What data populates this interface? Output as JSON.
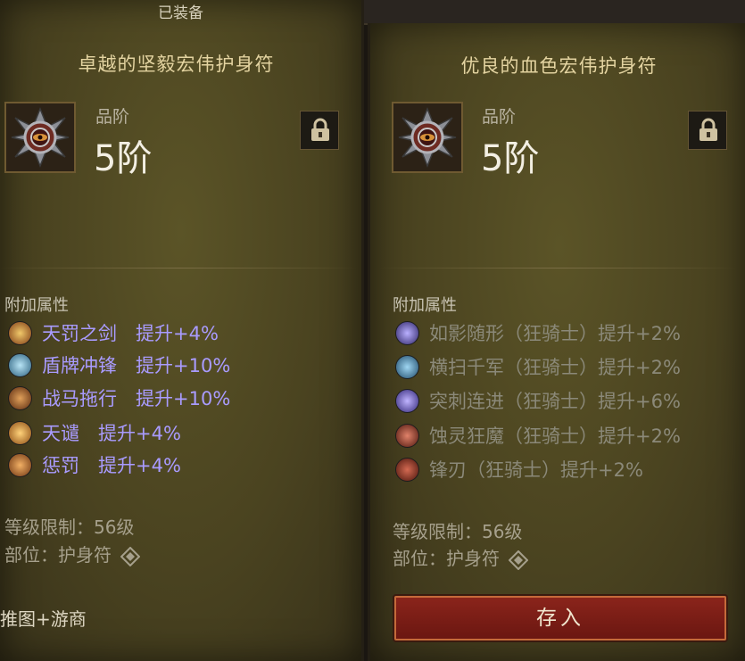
{
  "left_panel": {
    "equipped_label": "已装备",
    "title": "卓越的坚毅宏伟护身符",
    "tier_label": "品阶",
    "tier_value": "5阶",
    "affix_header": "附加属性",
    "affixes": [
      {
        "text": "天罚之剑　提升+4%",
        "icon": "sword-of-justice-icon",
        "color": "#d79a3a"
      },
      {
        "text": "盾牌冲锋　提升+10%",
        "icon": "shield-charge-icon",
        "color": "#5aa3c8"
      },
      {
        "text": "战马拖行　提升+10%",
        "icon": "war-horse-icon",
        "color": "#c27a2b"
      },
      {
        "text": "天谴　提升+4%",
        "icon": "condemn-icon",
        "color": "#e0a23a"
      },
      {
        "text": "惩罚　提升+4%",
        "icon": "punish-icon",
        "color": "#c9772d"
      }
    ],
    "level_req": "等级限制：56级",
    "slot": "部位：护身符",
    "vendor": "推图+游商"
  },
  "right_panel": {
    "title": "优良的血色宏伟护身符",
    "tier_label": "品阶",
    "tier_value": "5阶",
    "affix_header": "附加属性",
    "affixes": [
      {
        "text": "如影随形（狂骑士）提升+2%",
        "icon": "shadow-icon",
        "color": "#6a5fc4"
      },
      {
        "text": "横扫千军（狂骑士）提升+2%",
        "icon": "sweep-icon",
        "color": "#3b86b8"
      },
      {
        "text": "突刺连进（狂骑士）提升+6%",
        "icon": "thrust-icon",
        "color": "#6b57c9"
      },
      {
        "text": "蚀灵狂魔（狂骑士）提升+2%",
        "icon": "soul-eater-icon",
        "color": "#b8452e"
      },
      {
        "text": "锋刃（狂骑士）提升+2%",
        "icon": "blade-icon",
        "color": "#a7402c"
      }
    ],
    "level_req": "等级限制：56级",
    "slot": "部位：护身符",
    "store_button": "存入"
  },
  "colors": {
    "affix_blue": "#a99bff",
    "affix_gray": "#8b8979",
    "title_gold": "#e4d4a1",
    "button_red": "#7a1e16"
  }
}
